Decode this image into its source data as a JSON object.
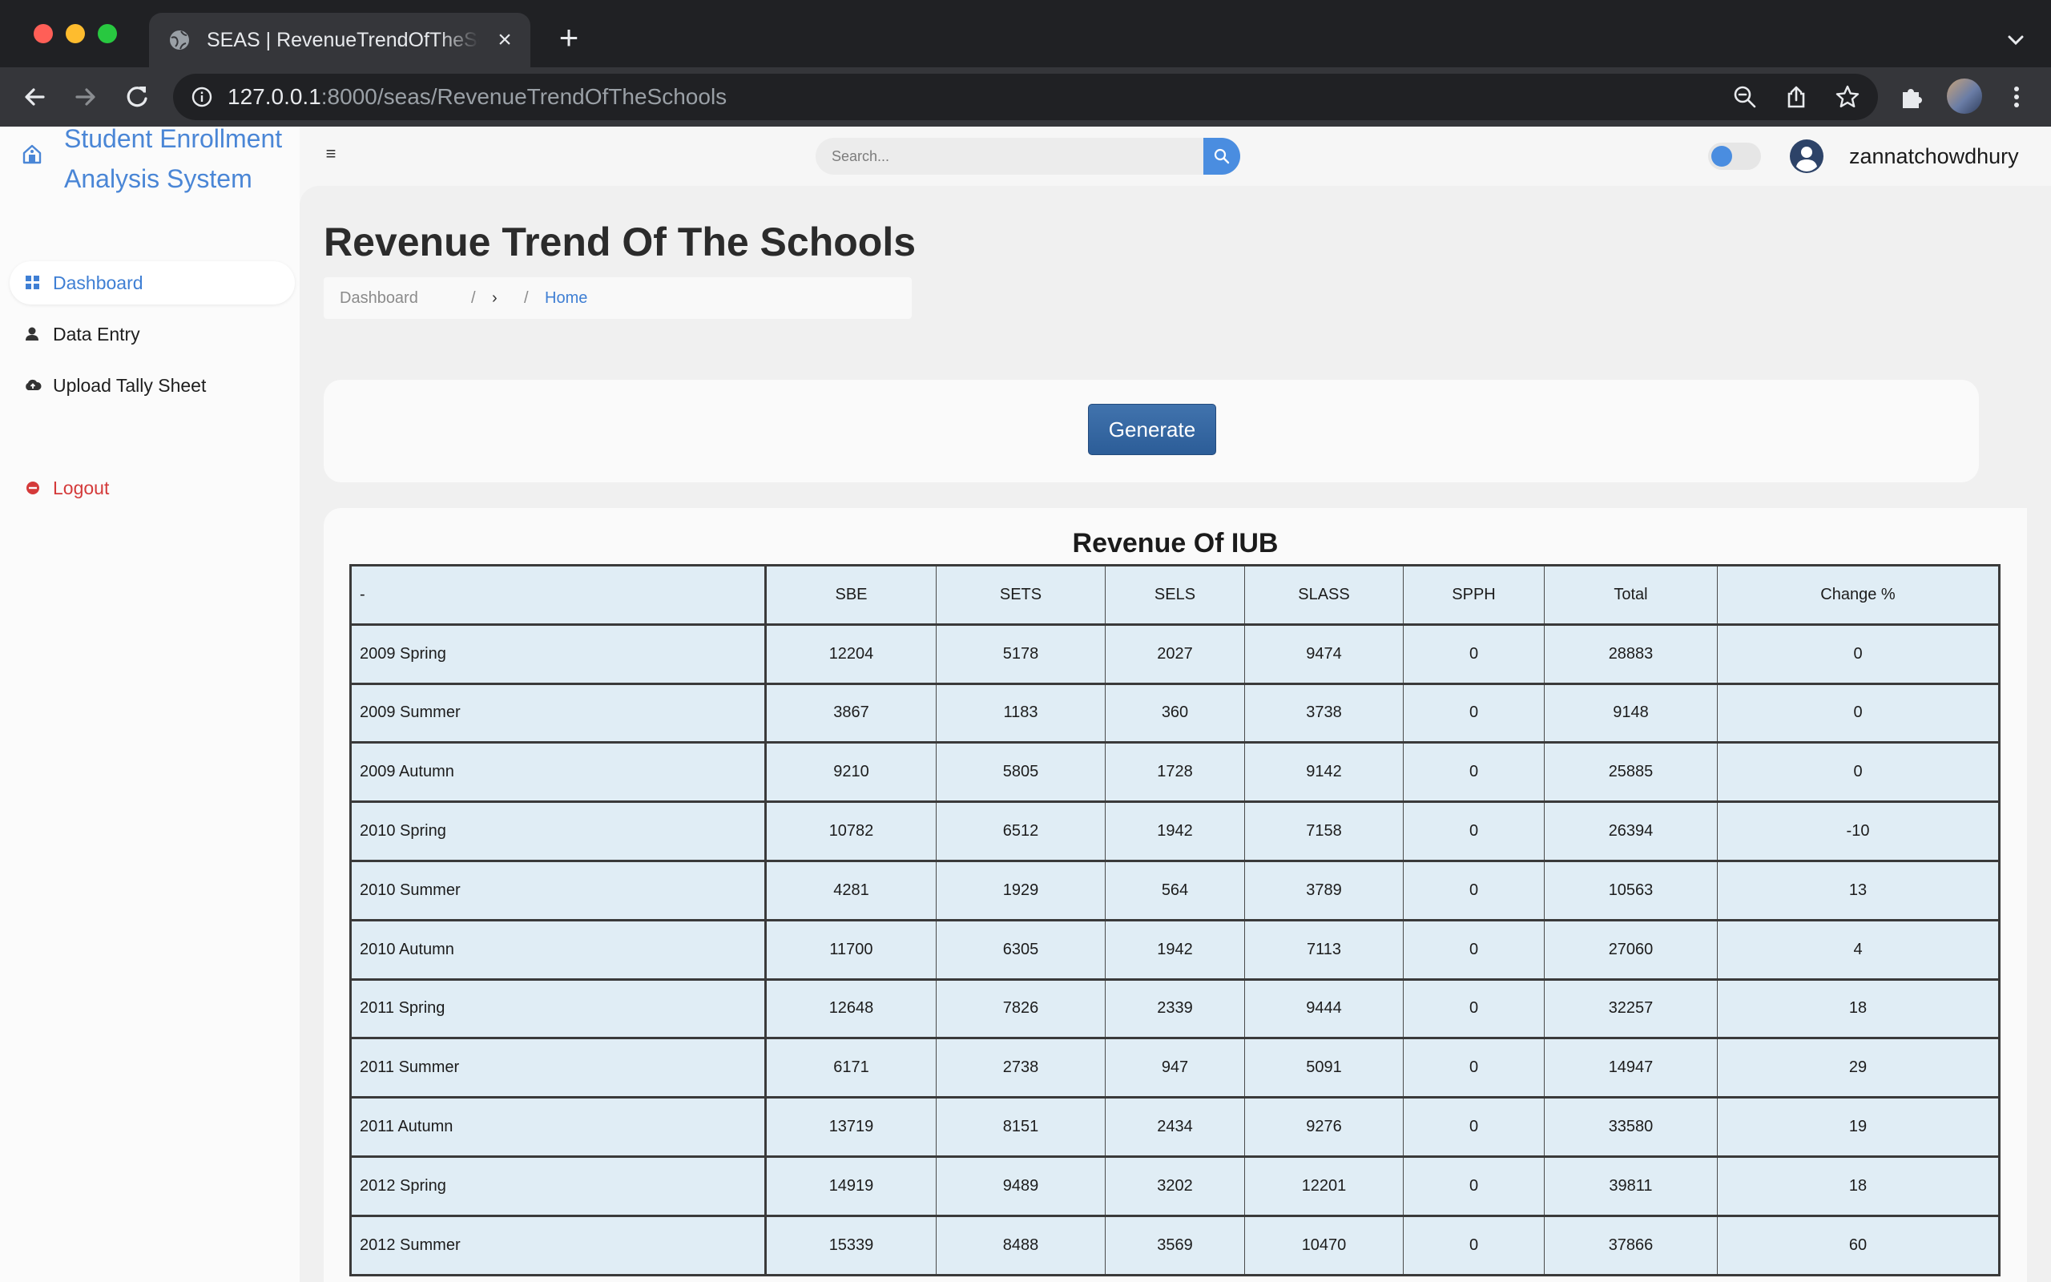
{
  "browser": {
    "tab_title": "SEAS | RevenueTrendOfTheSchools",
    "url_host": "127.0.0.1",
    "url_rest": ":8000/seas/RevenueTrendOfTheSchools"
  },
  "sidebar": {
    "brand_line1": "Student Enrollment",
    "brand_line2": "Analysis System",
    "items": [
      {
        "label": "Dashboard",
        "icon": "grid-icon"
      },
      {
        "label": "Data Entry",
        "icon": "user-icon"
      },
      {
        "label": "Upload Tally Sheet",
        "icon": "cloud-upload-icon"
      },
      {
        "label": "Logout",
        "icon": "logout-icon"
      }
    ]
  },
  "topbar": {
    "search_placeholder": "Search...",
    "username": "zannatchowdhury"
  },
  "main": {
    "title": "Revenue Trend Of The Schools",
    "breadcrumb": [
      "Dashboard",
      "/",
      "›",
      "/",
      "Home"
    ],
    "generate_label": "Generate",
    "table_title": "Revenue Of IUB",
    "headers": [
      "-",
      "SBE",
      "SETS",
      "SELS",
      "SLASS",
      "SPPH",
      "Total",
      "Change %"
    ],
    "rows": [
      [
        "2009 Spring",
        "12204",
        "5178",
        "2027",
        "9474",
        "0",
        "28883",
        "0"
      ],
      [
        "2009 Summer",
        "3867",
        "1183",
        "360",
        "3738",
        "0",
        "9148",
        "0"
      ],
      [
        "2009 Autumn",
        "9210",
        "5805",
        "1728",
        "9142",
        "0",
        "25885",
        "0"
      ],
      [
        "2010 Spring",
        "10782",
        "6512",
        "1942",
        "7158",
        "0",
        "26394",
        "-10"
      ],
      [
        "2010 Summer",
        "4281",
        "1929",
        "564",
        "3789",
        "0",
        "10563",
        "13"
      ],
      [
        "2010 Autumn",
        "11700",
        "6305",
        "1942",
        "7113",
        "0",
        "27060",
        "4"
      ],
      [
        "2011 Spring",
        "12648",
        "7826",
        "2339",
        "9444",
        "0",
        "32257",
        "18"
      ],
      [
        "2011 Summer",
        "6171",
        "2738",
        "947",
        "5091",
        "0",
        "14947",
        "29"
      ],
      [
        "2011 Autumn",
        "13719",
        "8151",
        "2434",
        "9276",
        "0",
        "33580",
        "19"
      ],
      [
        "2012 Spring",
        "14919",
        "9489",
        "3202",
        "12201",
        "0",
        "39811",
        "18"
      ],
      [
        "2012 Summer",
        "15339",
        "8488",
        "3569",
        "10470",
        "0",
        "37866",
        "60"
      ]
    ]
  },
  "colors": {
    "accent": "#4a86d6",
    "logout": "#d43a3a",
    "button": "#2c5d98",
    "table_cell": "#e0edf5"
  }
}
